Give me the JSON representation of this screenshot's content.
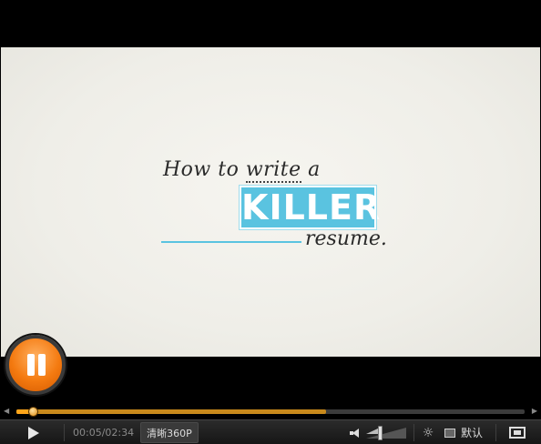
{
  "video": {
    "title_line1_plain": "How to ",
    "title_line1_dotted": "write",
    "title_line1_end": " a",
    "title_highlight": "KILLER",
    "title_line3": "resume."
  },
  "progress": {
    "played_fraction": 0.033,
    "buffered_fraction": 0.61
  },
  "controls": {
    "time": "00:05/02:34",
    "quality": "清晰360P",
    "volume_fraction": 0.35,
    "screen_mode_label": "默认"
  },
  "colors": {
    "accent": "#ffa51a",
    "title_highlight_bg": "#5ac3e0"
  }
}
